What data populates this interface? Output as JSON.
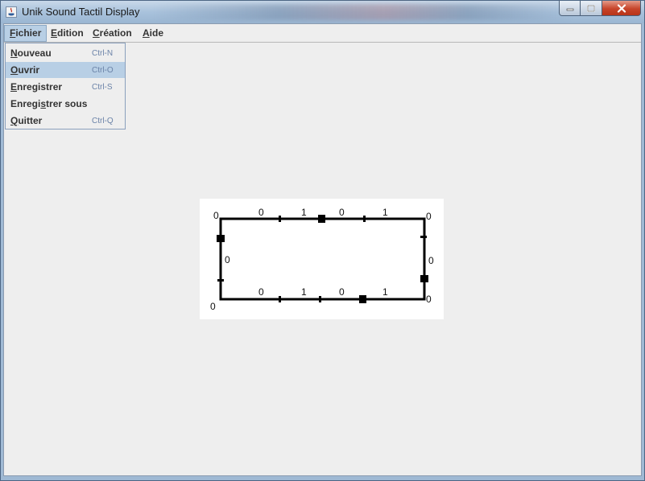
{
  "window": {
    "title": "Unik Sound Tactil Display"
  },
  "menubar": {
    "menus": [
      {
        "mnemonic": "F",
        "rest": "ichier"
      },
      {
        "mnemonic": "E",
        "rest": "dition"
      },
      {
        "mnemonic": "C",
        "rest": "réation"
      },
      {
        "mnemonic": "A",
        "rest": "ide"
      }
    ]
  },
  "file_menu": {
    "items": [
      {
        "mnemonic": "N",
        "rest": "ouveau",
        "shortcut": "Ctrl-N"
      },
      {
        "mnemonic": "O",
        "rest": "uvrir",
        "shortcut": "Ctrl-O"
      },
      {
        "mnemonic": "E",
        "rest": "nregistrer",
        "shortcut": "Ctrl-S"
      },
      {
        "pre": "Enregi",
        "mnemonic": "s",
        "rest": "trer sous",
        "shortcut": ""
      },
      {
        "mnemonic": "Q",
        "rest": "uitter",
        "shortcut": "Ctrl-Q"
      }
    ],
    "highlighted_index": 1
  },
  "diagram": {
    "top_left_corner": "0",
    "top_right_corner": "0",
    "bottom_left_corner": "0",
    "bottom_right_corner": "0",
    "top_labels": [
      "0",
      "1",
      "0",
      "1"
    ],
    "bottom_labels": [
      "0",
      "1",
      "0",
      "1"
    ],
    "left_label": "0",
    "right_label": "0"
  },
  "colors": {
    "highlight": "#b8cfe5",
    "shortcut_text": "#6b83a8",
    "client_bg": "#eeeeee"
  }
}
